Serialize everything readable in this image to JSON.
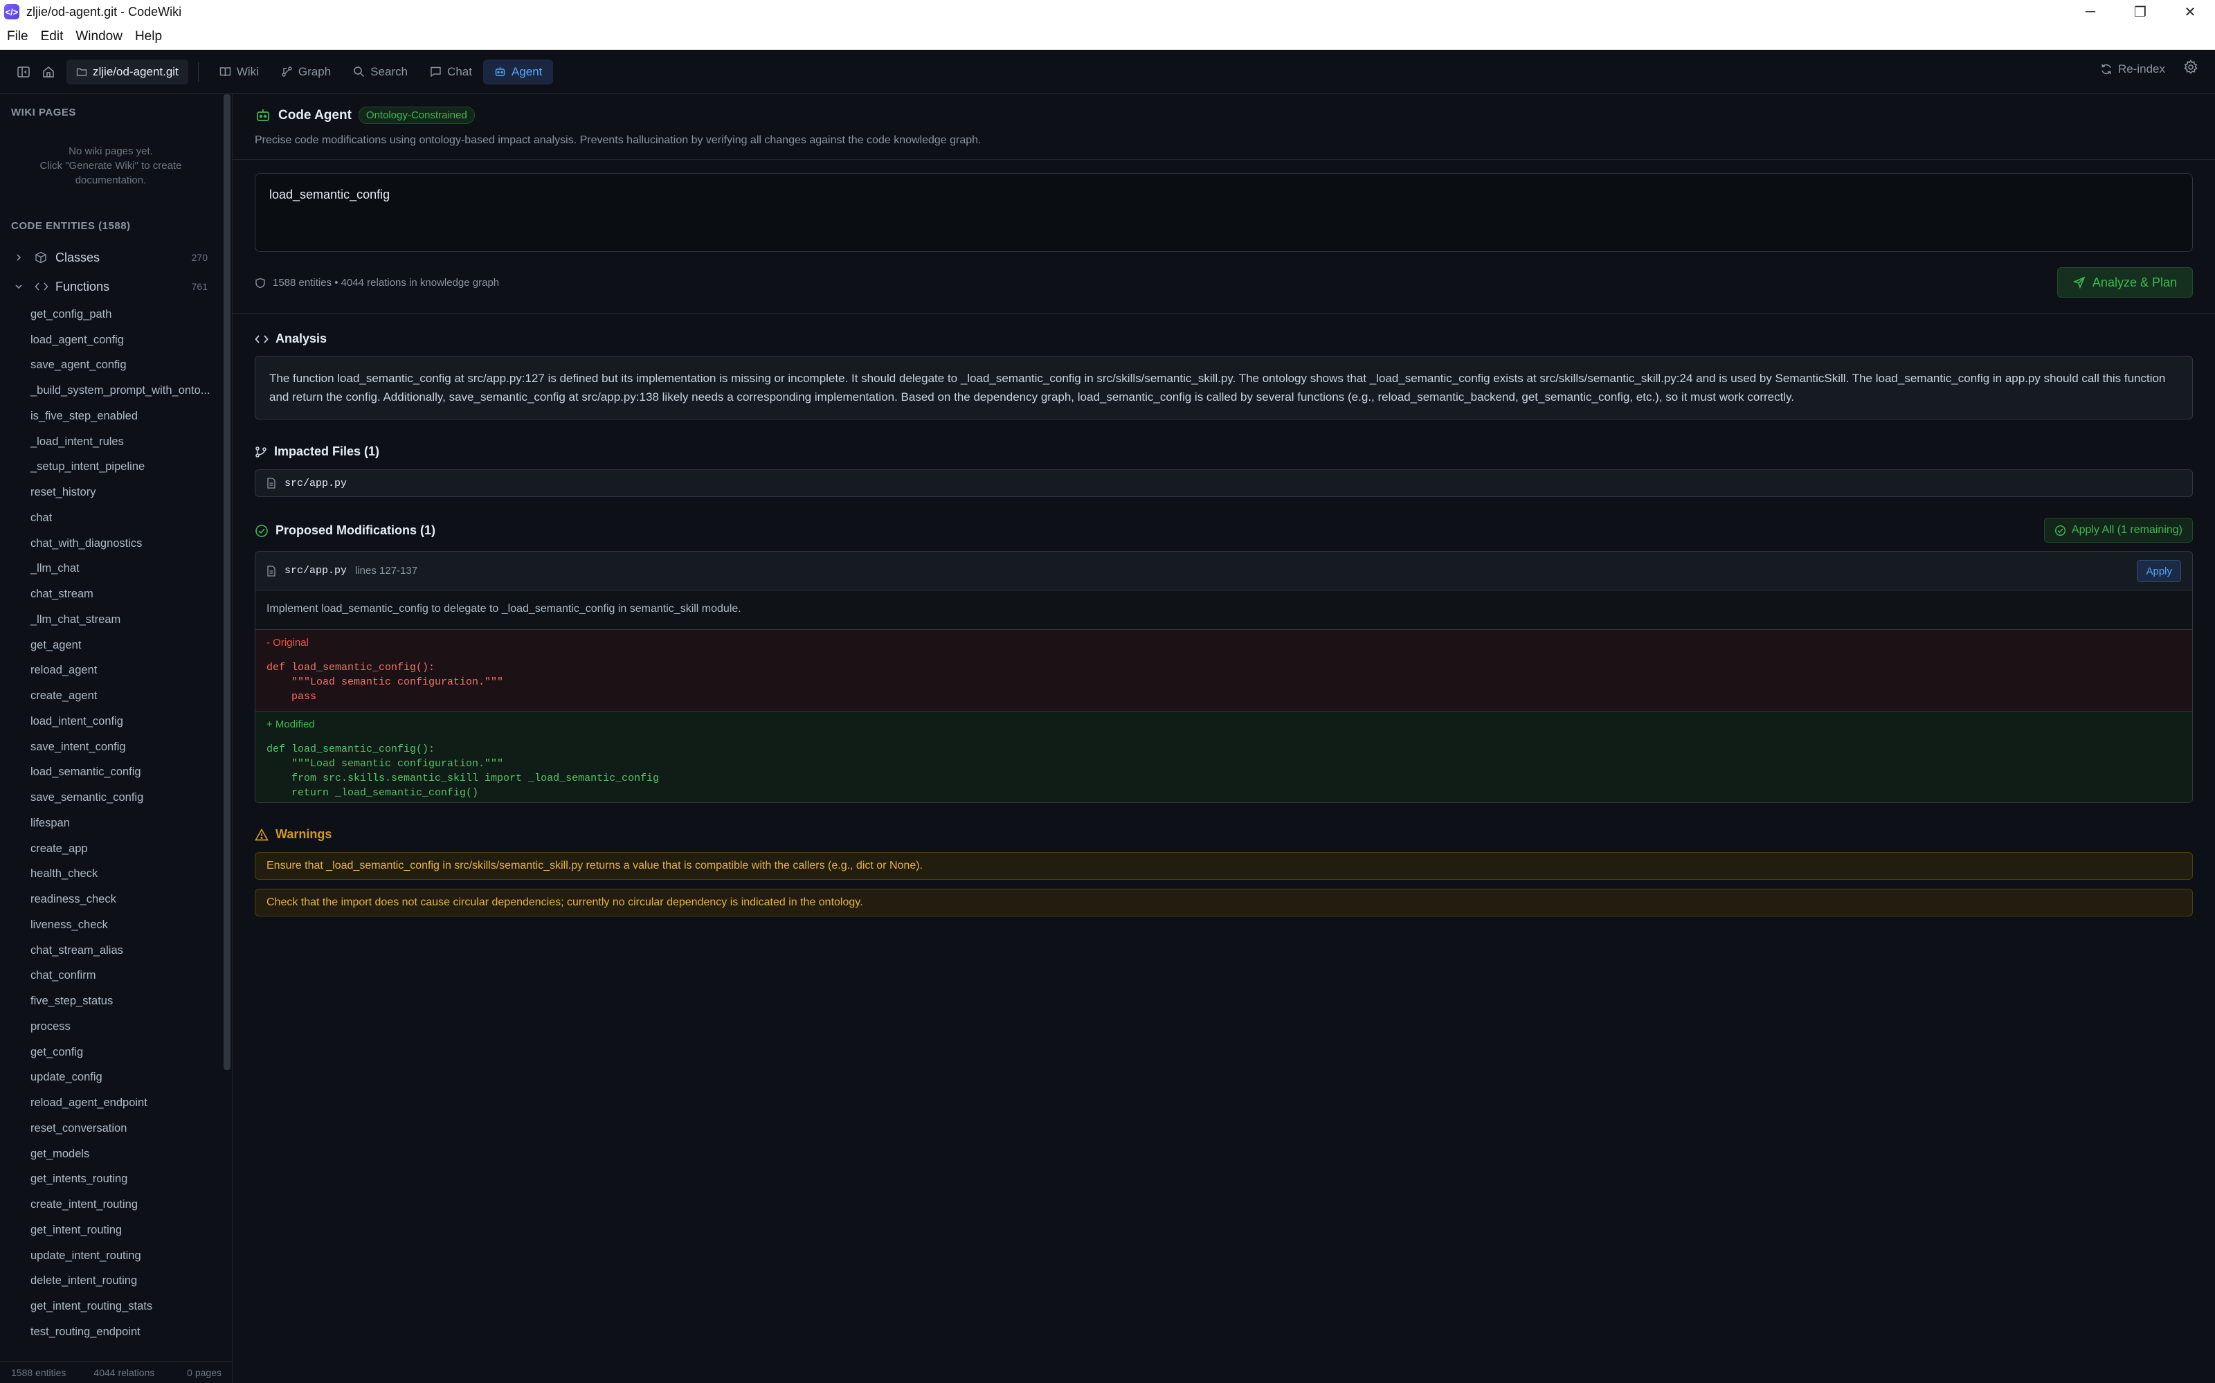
{
  "window": {
    "title": "zljie/od-agent.git - CodeWiki",
    "app_icon_glyph": "</>",
    "controls": {
      "minimize": "─",
      "maximize": "❐",
      "close": "✕"
    }
  },
  "menu": [
    "File",
    "Edit",
    "Window",
    "Help"
  ],
  "toolbar": {
    "repo": "zljie/od-agent.git",
    "tabs": [
      {
        "label": "Wiki",
        "icon": "book-icon",
        "active": false
      },
      {
        "label": "Graph",
        "icon": "graph-icon",
        "active": false
      },
      {
        "label": "Search",
        "icon": "search-icon",
        "active": false
      },
      {
        "label": "Chat",
        "icon": "chat-icon",
        "active": false
      },
      {
        "label": "Agent",
        "icon": "robot-icon",
        "active": true
      }
    ],
    "reindex_label": "Re-index"
  },
  "sidebar": {
    "wiki_heading": "WIKI PAGES",
    "wiki_empty_line1": "No wiki pages yet.",
    "wiki_empty_line2": "Click \"Generate Wiki\" to create",
    "wiki_empty_line3": "documentation.",
    "entities_heading": "CODE ENTITIES (1588)",
    "classes": {
      "label": "Classes",
      "count": "270"
    },
    "functions": {
      "label": "Functions",
      "count": "761"
    },
    "function_items": [
      "get_config_path",
      "load_agent_config",
      "save_agent_config",
      "_build_system_prompt_with_onto...",
      "is_five_step_enabled",
      "_load_intent_rules",
      "_setup_intent_pipeline",
      "reset_history",
      "chat",
      "chat_with_diagnostics",
      "_llm_chat",
      "chat_stream",
      "_llm_chat_stream",
      "get_agent",
      "reload_agent",
      "create_agent",
      "load_intent_config",
      "save_intent_config",
      "load_semantic_config",
      "save_semantic_config",
      "lifespan",
      "create_app",
      "health_check",
      "readiness_check",
      "liveness_check",
      "chat_stream_alias",
      "chat_confirm",
      "five_step_status",
      "process",
      "get_config",
      "update_config",
      "reload_agent_endpoint",
      "reset_conversation",
      "get_models",
      "get_intents_routing",
      "create_intent_routing",
      "get_intent_routing",
      "update_intent_routing",
      "delete_intent_routing",
      "get_intent_routing_stats",
      "test_routing_endpoint"
    ],
    "footer": {
      "entities": "1588 entities",
      "relations": "4044 relations",
      "pages": "0 pages"
    }
  },
  "agent": {
    "title": "Code Agent",
    "badge": "Ontology-Constrained",
    "description": "Precise code modifications using ontology-based impact analysis. Prevents hallucination by verifying all changes against the code knowledge graph.",
    "query": "load_semantic_config",
    "stats": "1588 entities • 4044 relations in knowledge graph",
    "analyze_label": "Analyze & Plan"
  },
  "analysis": {
    "title": "Analysis",
    "text": "The function load_semantic_config at src/app.py:127 is defined but its implementation is missing or incomplete. It should delegate to _load_semantic_config in src/skills/semantic_skill.py. The ontology shows that _load_semantic_config exists at src/skills/semantic_skill.py:24 and is used by SemanticSkill. The load_semantic_config in app.py should call this function and return the config. Additionally, save_semantic_config at src/app.py:138 likely needs a corresponding implementation. Based on the dependency graph, load_semantic_config is called by several functions (e.g., reload_semantic_backend, get_semantic_config, etc.), so it must work correctly."
  },
  "impacted": {
    "title": "Impacted Files (1)",
    "files": [
      "src/app.py"
    ]
  },
  "modifications": {
    "title": "Proposed Modifications (1)",
    "apply_all_label": "Apply All (1 remaining)",
    "item": {
      "file": "src/app.py",
      "lines": "lines 127-137",
      "apply_label": "Apply",
      "description": "Implement load_semantic_config to delegate to _load_semantic_config in semantic_skill module.",
      "original_label": "- Original",
      "original_code": "def load_semantic_config():\n    \"\"\"Load semantic configuration.\"\"\"\n    pass",
      "modified_label": "+ Modified",
      "modified_code": "def load_semantic_config():\n    \"\"\"Load semantic configuration.\"\"\"\n    from src.skills.semantic_skill import _load_semantic_config\n    return _load_semantic_config()"
    }
  },
  "warnings": {
    "title": "Warnings",
    "items": [
      "Ensure that _load_semantic_config in src/skills/semantic_skill.py returns a value that is compatible with the callers (e.g., dict or None).",
      "Check that the import does not cause circular dependencies; currently no circular dependency is indicated in the ontology."
    ]
  },
  "colors": {
    "accent": "#58a6ff",
    "success": "#3fb950",
    "warning": "#d29922",
    "danger": "#f85149",
    "background": "#0d1117"
  }
}
